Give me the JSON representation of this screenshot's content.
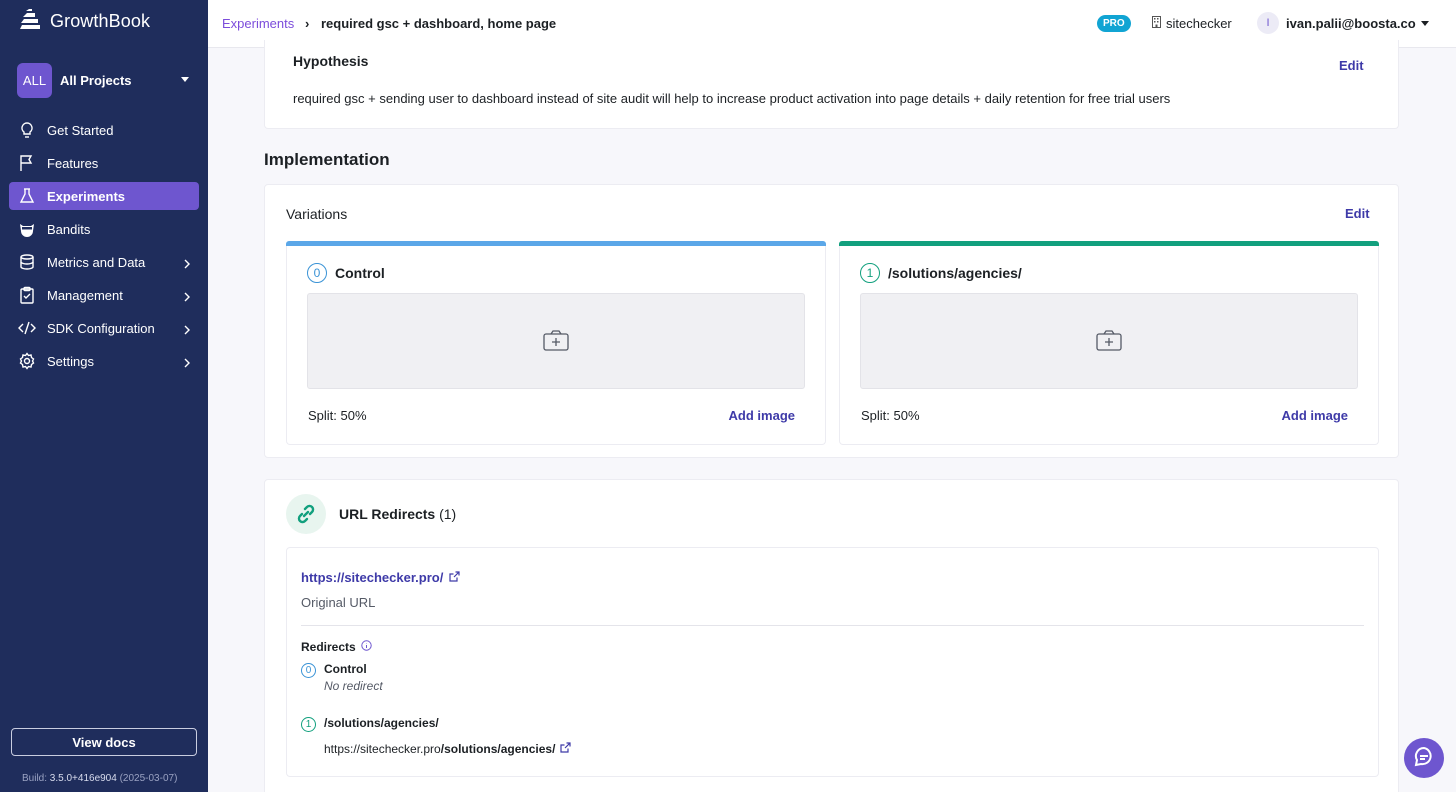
{
  "app": {
    "name": "GrowthBook"
  },
  "project": {
    "badge": "ALL",
    "name": "All Projects"
  },
  "sidebar": {
    "items": [
      {
        "label": "Get Started",
        "icon": "lightbulb-icon"
      },
      {
        "label": "Features",
        "icon": "flag-icon"
      },
      {
        "label": "Experiments",
        "icon": "flask-icon",
        "active": true
      },
      {
        "label": "Bandits",
        "icon": "bandit-icon"
      },
      {
        "label": "Metrics and Data",
        "icon": "database-icon",
        "chevron": true
      },
      {
        "label": "Management",
        "icon": "clipboard-icon",
        "chevron": true
      },
      {
        "label": "SDK Configuration",
        "icon": "code-icon",
        "chevron": true
      },
      {
        "label": "Settings",
        "icon": "gear-icon",
        "chevron": true
      }
    ],
    "view_docs": "View docs",
    "build_label": "Build:",
    "build_version": "3.5.0+416e904",
    "build_date": "(2025-03-07)"
  },
  "header": {
    "breadcrumb_link": "Experiments",
    "breadcrumb_sep": "›",
    "title": "required gsc + dashboard, home page",
    "plan_badge": "PRO",
    "org": "sitechecker",
    "avatar_initial": "I",
    "user_email": "ivan.palii@boosta.co"
  },
  "hypothesis": {
    "title": "Hypothesis",
    "edit": "Edit",
    "text": "required gsc + sending user to dashboard instead of site audit will help to increase product activation into page details + daily retention for free trial users"
  },
  "implementation": {
    "title": "Implementation",
    "variations_title": "Variations",
    "edit": "Edit",
    "variations": [
      {
        "index": "0",
        "name": "Control",
        "split": "Split: 50%",
        "add_image": "Add image",
        "color": "#5ba7e8"
      },
      {
        "index": "1",
        "name": "/solutions/agencies/",
        "split": "Split: 50%",
        "add_image": "Add image",
        "color": "#12a07e"
      }
    ]
  },
  "redirects": {
    "title": "URL Redirects",
    "count": "(1)",
    "original_url": "https://sitechecker.pro/",
    "original_label": "Original URL",
    "redirects_label": "Redirects",
    "items": [
      {
        "index": "0",
        "name": "Control",
        "sub": "No redirect"
      },
      {
        "index": "1",
        "name": "/solutions/agencies/",
        "url_base": "https://sitechecker.pro",
        "url_path": "/solutions/agencies/"
      }
    ]
  },
  "colors": {
    "sidebar_bg": "#1f2d5c",
    "accent": "#6e56cf",
    "link": "#3e3aa8",
    "control": "#5ba7e8",
    "variant": "#12a07e"
  }
}
